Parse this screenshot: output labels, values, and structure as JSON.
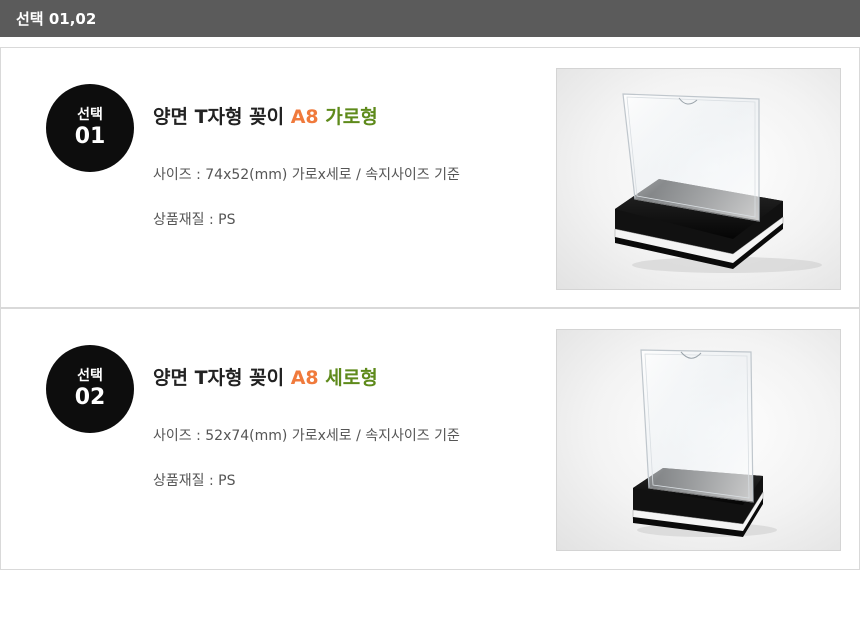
{
  "header": {
    "title": "선택 01,02"
  },
  "options": [
    {
      "badge_label": "선택",
      "badge_number": "01",
      "title_main": "양면 T자형 꽂이 ",
      "title_size": "A8",
      "title_orientation": "가로형",
      "size_text": "사이즈 : 74x52(mm) 가로x세로 / 속지사이즈 기준",
      "material_text": "상품재질 : PS",
      "image_name": "horizontal-acrylic-stand-photo"
    },
    {
      "badge_label": "선택",
      "badge_number": "02",
      "title_main": "양면 T자형 꽂이 ",
      "title_size": "A8",
      "title_orientation": "세로형",
      "size_text": "사이즈 : 52x74(mm) 가로x세로 / 속지사이즈 기준",
      "material_text": "상품재질 : PS",
      "image_name": "vertical-acrylic-stand-photo"
    }
  ],
  "colors": {
    "header_bg": "#5b5b5b",
    "badge_bg": "#0d0d0d",
    "accent_orange": "#f07a3c",
    "accent_green": "#5e8a1b"
  }
}
